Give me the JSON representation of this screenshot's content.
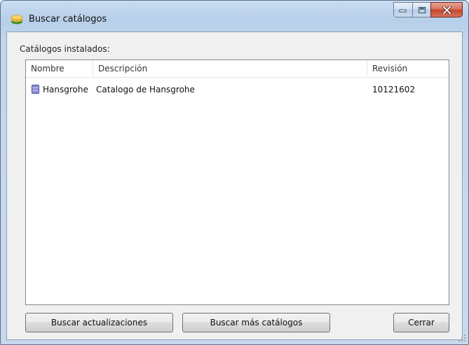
{
  "window": {
    "title": "Buscar catálogos",
    "icon": "catalog-app-icon",
    "caption_buttons": [
      "minimize",
      "maximize",
      "close"
    ]
  },
  "catalogs": {
    "label": "Catálogos instalados:",
    "columns": [
      "Nombre",
      "Descripción",
      "Revisión"
    ],
    "rows": [
      {
        "name": "Hansgrohe",
        "description": "Catalogo de Hansgrohe",
        "revision": "10121602",
        "icon": "database-icon"
      }
    ]
  },
  "buttons": {
    "check_updates": "Buscar actualizaciones",
    "find_more": "Buscar más catálogos",
    "close": "Cerrar"
  },
  "colors": {
    "titlebar": "#b7cfe9",
    "client_bg": "#f0f0f0",
    "close_button": "#c8452b"
  }
}
